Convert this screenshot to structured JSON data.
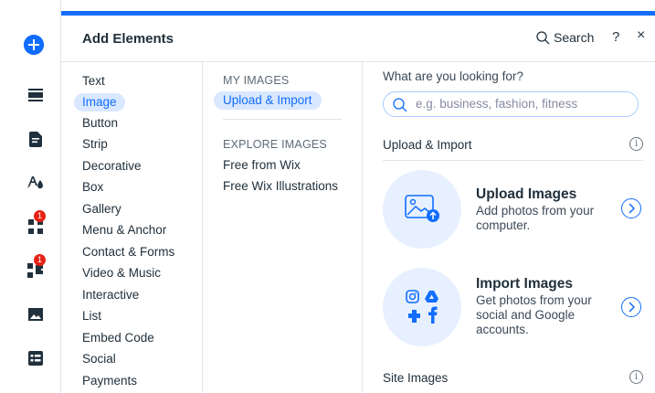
{
  "header": {
    "title": "Add Elements",
    "search_label": "Search",
    "help_label": "?",
    "close_label": "×"
  },
  "rail": {
    "add_icon": "plus-icon",
    "items": [
      {
        "icon": "sections-icon"
      },
      {
        "icon": "page-icon"
      },
      {
        "icon": "design-fonts-icon"
      },
      {
        "icon": "apps-icon",
        "badge": "1"
      },
      {
        "icon": "puzzle-icon",
        "badge": "1"
      },
      {
        "icon": "media-icon"
      },
      {
        "icon": "table-icon"
      }
    ]
  },
  "categories": [
    "Text",
    "Image",
    "Button",
    "Strip",
    "Decorative",
    "Box",
    "Gallery",
    "Menu & Anchor",
    "Contact & Forms",
    "Video & Music",
    "Interactive",
    "List",
    "Embed Code",
    "Social",
    "Payments"
  ],
  "active_category": "Image",
  "subpanel": {
    "my_images_title": "MY IMAGES",
    "upload_import": "Upload & Import",
    "explore_title": "EXPLORE IMAGES",
    "free_from_wix": "Free from Wix",
    "free_illustrations": "Free Wix Illustrations"
  },
  "content": {
    "question": "What are you looking for?",
    "search_placeholder": "e.g. business, fashion, fitness",
    "section_upload": "Upload & Import",
    "upload_title": "Upload Images",
    "upload_desc": "Add photos from your computer.",
    "import_title": "Import Images",
    "import_desc": "Get photos from your social and Google accounts.",
    "section_site": "Site Images"
  },
  "colors": {
    "accent": "#116dff",
    "badge": "#e62214",
    "highlight": "#d9e8ff"
  }
}
